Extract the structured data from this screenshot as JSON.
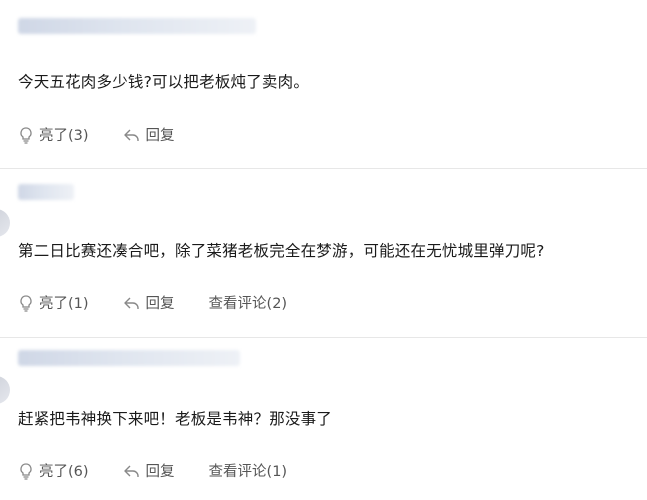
{
  "comments": [
    {
      "content": "今天五花肉多少钱?可以把老板炖了卖肉。",
      "like_label": "亮了(3)",
      "reply_label": "回复",
      "view_label": ""
    },
    {
      "content": "第二日比赛还凑合吧，除了菜猪老板完全在梦游，可能还在无忧城里弹刀呢?",
      "like_label": "亮了(1)",
      "reply_label": "回复",
      "view_label": "查看评论(2)"
    },
    {
      "content": "赶紧把韦神换下来吧！老板是韦神？那没事了",
      "like_label": "亮了(6)",
      "reply_label": "回复",
      "view_label": "查看评论(1)"
    }
  ],
  "icons": {
    "like": "lightbulb-icon",
    "reply": "reply-arrow-icon"
  },
  "colors": {
    "text": "#1a1a1a",
    "action": "#555555",
    "divider": "#e7e7e7"
  }
}
